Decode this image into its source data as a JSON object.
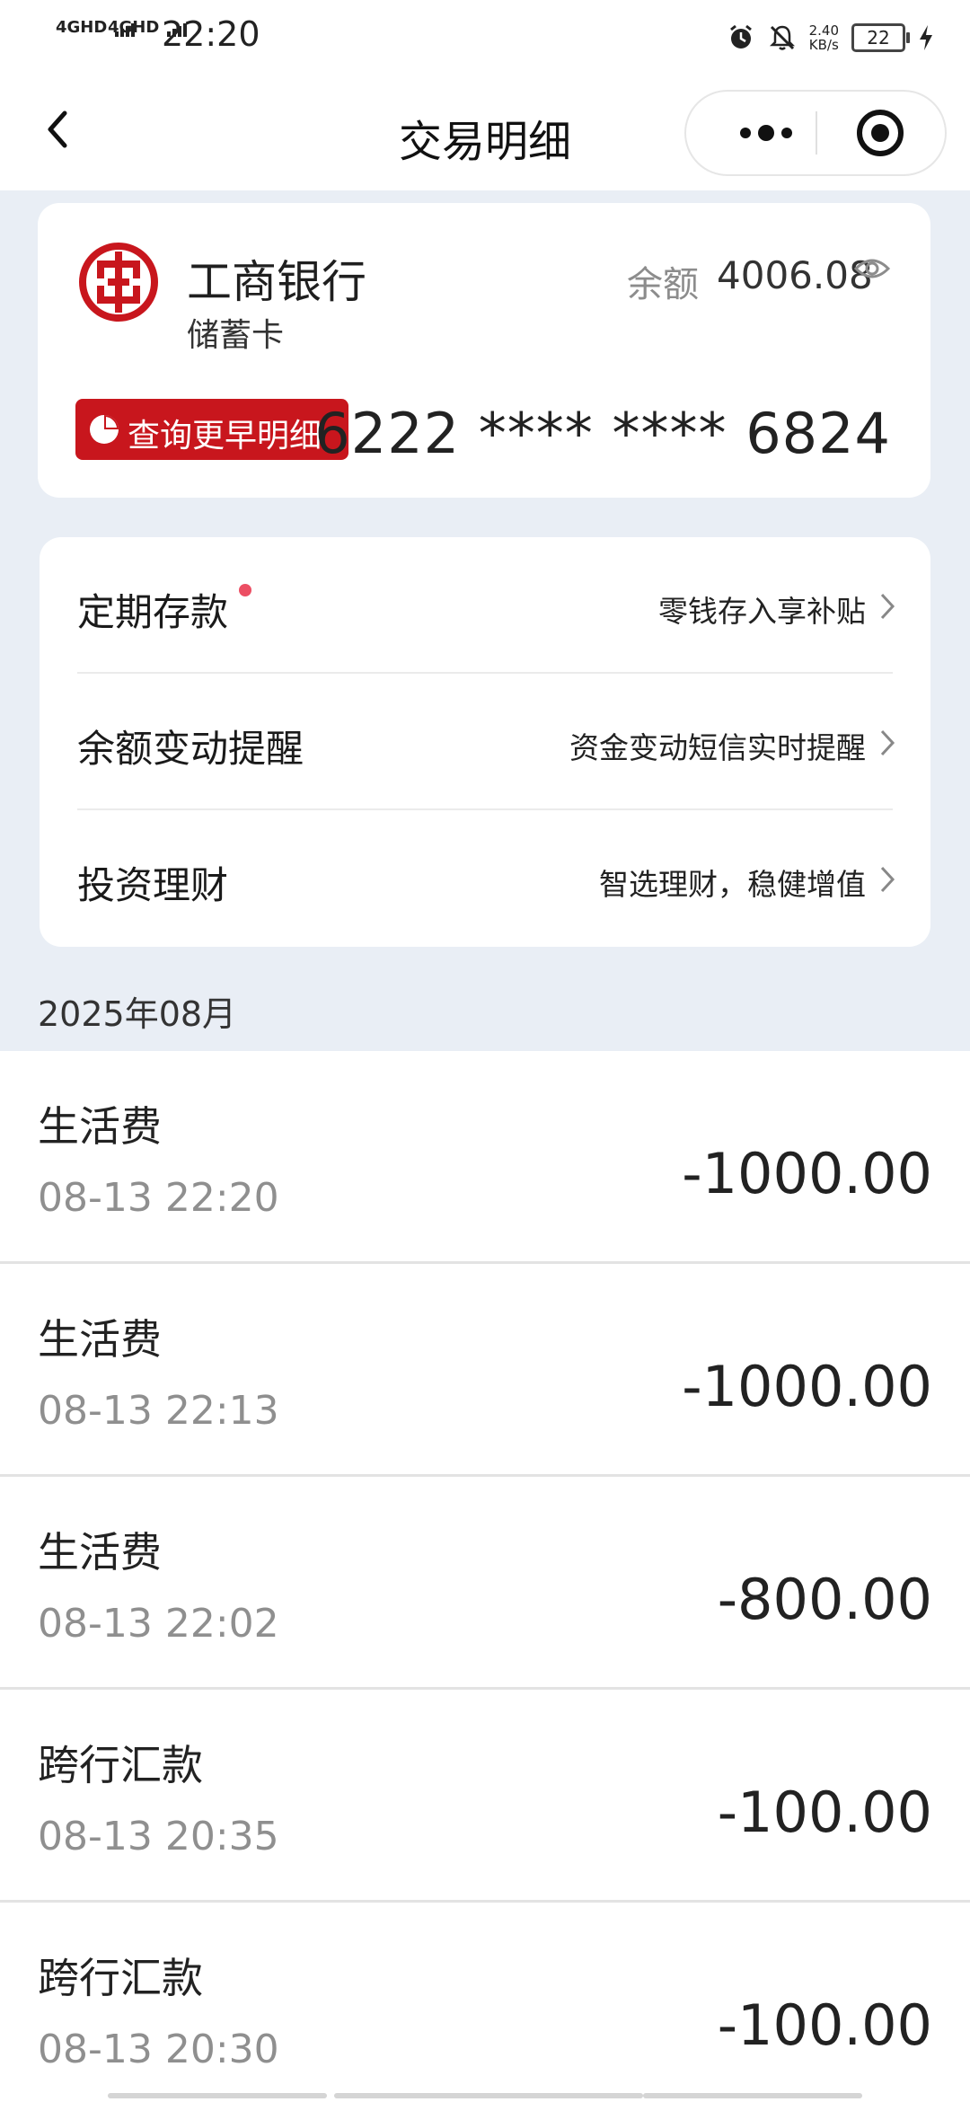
{
  "status_bar": {
    "signal1": "4GHD",
    "signal2": "4GHD",
    "time": "22:20",
    "net_speed_value": "2.40",
    "net_speed_unit": "KB/s",
    "battery": "22"
  },
  "nav": {
    "title": "交易明细"
  },
  "account_card": {
    "bank_name": "工商银行",
    "card_type": "储蓄卡",
    "balance_label": "余额",
    "balance_value": "4006.08",
    "early_query_label": "查询更早明细",
    "card_number": "6222 **** **** 6824",
    "brand_color": "#c8161d"
  },
  "services": [
    {
      "label": "定期存款",
      "desc": "零钱存入享补贴",
      "has_dot": true
    },
    {
      "label": "余额变动提醒",
      "desc": "资金变动短信实时提醒",
      "has_dot": false
    },
    {
      "label": "投资理财",
      "desc": "智选理财，稳健增值",
      "has_dot": false
    }
  ],
  "month_header": "2025年08月",
  "transactions": [
    {
      "name": "生活费",
      "time": "08-13 22:20",
      "amount": "-1000.00"
    },
    {
      "name": "生活费",
      "time": "08-13 22:13",
      "amount": "-1000.00"
    },
    {
      "name": "生活费",
      "time": "08-13 22:02",
      "amount": "-800.00"
    },
    {
      "name": "跨行汇款",
      "time": "08-13 20:35",
      "amount": "-100.00"
    },
    {
      "name": "跨行汇款",
      "time": "08-13 20:30",
      "amount": "-100.00"
    }
  ]
}
